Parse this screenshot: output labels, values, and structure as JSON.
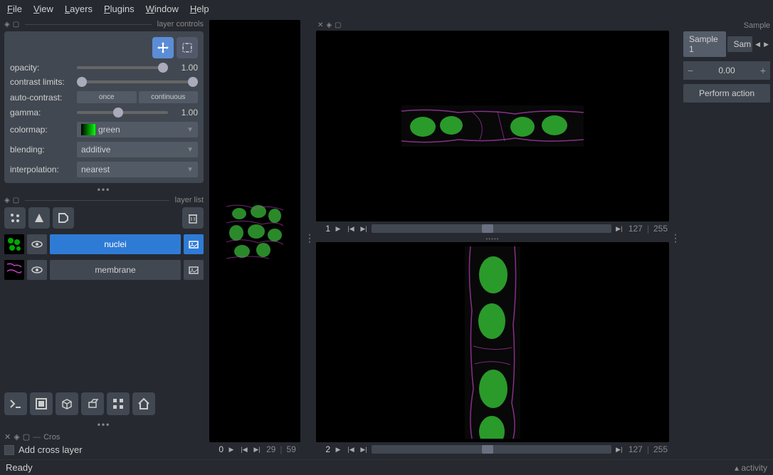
{
  "menu": {
    "file": "File",
    "view": "View",
    "layers": "Layers",
    "plugins": "Plugins",
    "window": "Window",
    "help": "Help"
  },
  "panels": {
    "layer_controls": "layer controls",
    "layer_list": "layer list",
    "cross": "Cros",
    "sample": "Sample"
  },
  "controls": {
    "opacity_label": "opacity:",
    "opacity_value": "1.00",
    "contrast_label": "contrast limits:",
    "auto_contrast_label": "auto-contrast:",
    "auto_once": "once",
    "auto_cont": "continuous",
    "gamma_label": "gamma:",
    "gamma_value": "1.00",
    "colormap_label": "colormap:",
    "colormap_value": "green",
    "blending_label": "blending:",
    "blending_value": "additive",
    "interpolation_label": "interpolation:",
    "interpolation_value": "nearest"
  },
  "layers": [
    {
      "name": "nuclei",
      "selected": true
    },
    {
      "name": "membrane",
      "selected": false
    }
  ],
  "cross": {
    "add_label": "Add cross layer"
  },
  "slices": {
    "thumb_idx": "0",
    "thumb_cur": "29",
    "thumb_max": "59",
    "top_idx": "1",
    "top_cur": "127",
    "top_max": "255",
    "bot_idx": "2",
    "bot_cur": "127",
    "bot_max": "255"
  },
  "right": {
    "tab1": "Sample 1",
    "tab2": "Sam",
    "spinner_value": "0.00",
    "action": "Perform action"
  },
  "status": {
    "ready": "Ready",
    "activity": "activity"
  }
}
